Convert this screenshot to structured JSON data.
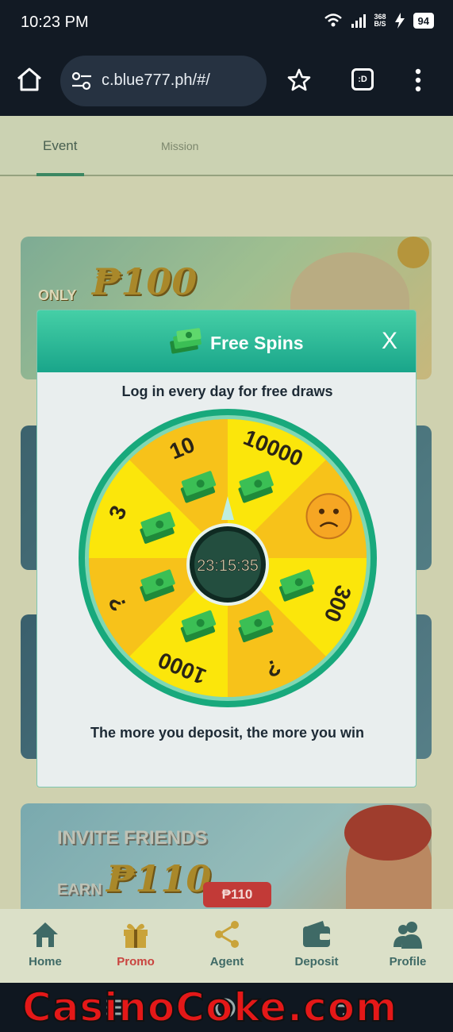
{
  "status": {
    "time": "10:23 PM",
    "net_speed_top": "368",
    "net_speed_bottom": "B/S",
    "battery": "94"
  },
  "browser": {
    "url": "c.blue777.ph/#/",
    "tabs_label": ":D"
  },
  "page_tabs": [
    {
      "label": "Event"
    },
    {
      "label": "Mission"
    }
  ],
  "banners": {
    "b1_small": "ONLY",
    "b1_amount": "₱100",
    "b4_title": "INVITE FRIENDS",
    "b4_earn": "EARN",
    "b4_amount": "₱110"
  },
  "modal": {
    "title": "Free Spins",
    "close": "X",
    "subtitle": "Log in every day for free draws",
    "footer": "The more you deposit, the more you win",
    "timer": "23:15:35",
    "segments": [
      {
        "label": "10000",
        "kind": "text"
      },
      {
        "label": "sad-face",
        "kind": "icon"
      },
      {
        "label": "300",
        "kind": "text"
      },
      {
        "label": "?",
        "kind": "text"
      },
      {
        "label": "1000",
        "kind": "text"
      },
      {
        "label": "?",
        "kind": "text"
      },
      {
        "label": "3",
        "kind": "text"
      },
      {
        "label": "10",
        "kind": "text"
      }
    ]
  },
  "bottom_nav": {
    "badge": "₱110",
    "items": [
      {
        "label": "Home",
        "icon": "home-icon"
      },
      {
        "label": "Promo",
        "icon": "gift-icon",
        "active": true
      },
      {
        "label": "Agent",
        "icon": "share-icon"
      },
      {
        "label": "Deposit",
        "icon": "wallet-icon"
      },
      {
        "label": "Profile",
        "icon": "users-icon"
      }
    ]
  },
  "watermark": "CasinoCoke.com",
  "colors": {
    "accent": "#19a58a",
    "wheel_ring": "#16b07f",
    "wheel_gold": "#f7c21a",
    "wheel_yellow": "#fbe60b",
    "promo_active": "#c9443f"
  }
}
